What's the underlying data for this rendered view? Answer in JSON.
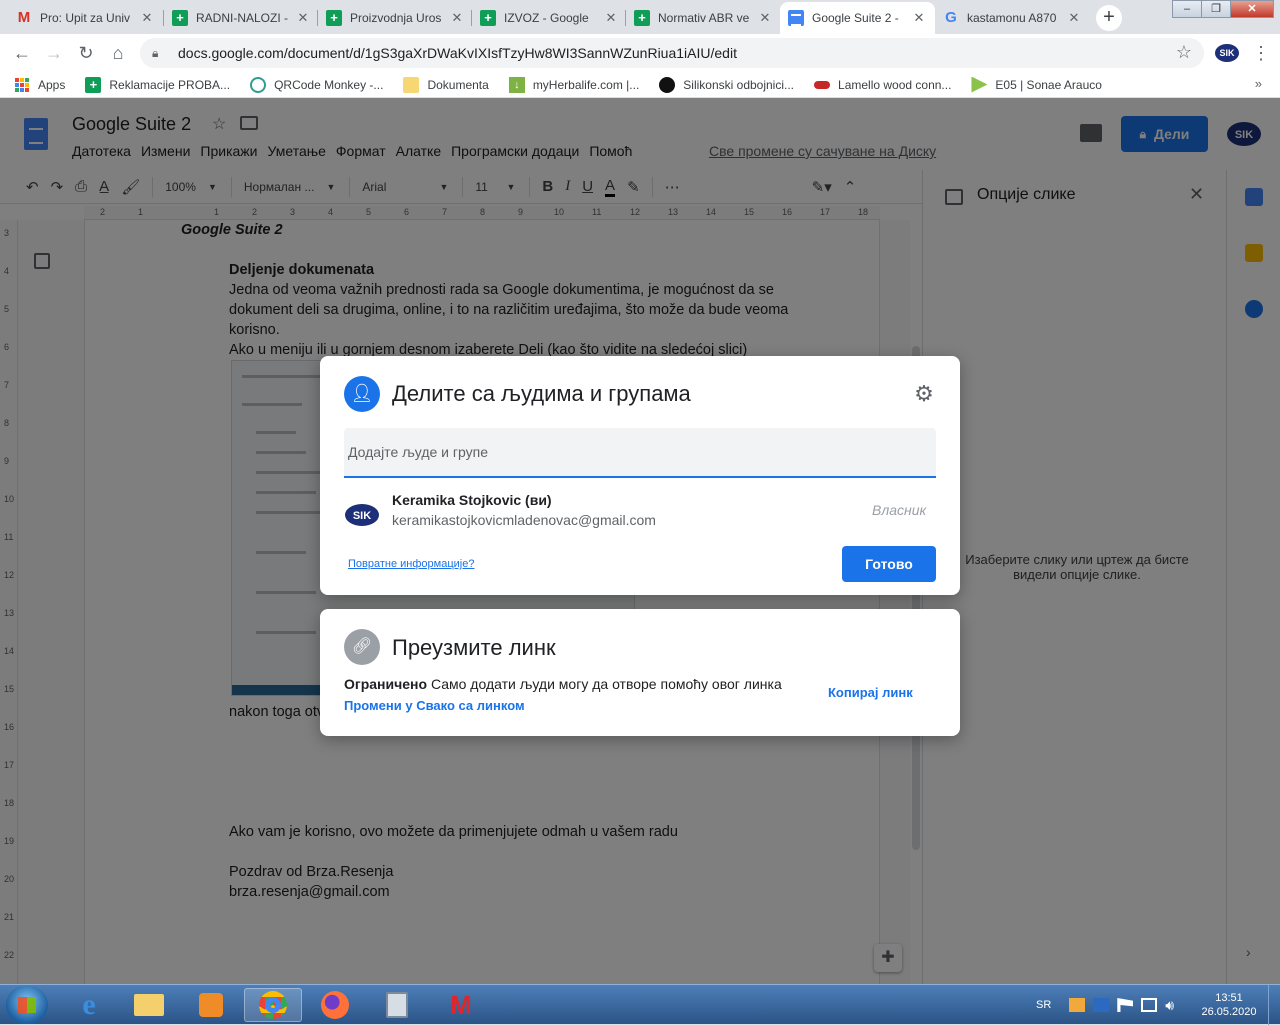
{
  "browser": {
    "tabs": [
      {
        "title": "Pro: Upit za Univ",
        "icon": "gmail-icon"
      },
      {
        "title": "RADNI-NALOZI -",
        "icon": "sheets-icon"
      },
      {
        "title": "Proizvodnja Uros",
        "icon": "sheets-icon"
      },
      {
        "title": "IZVOZ - Google",
        "icon": "sheets-icon"
      },
      {
        "title": "Normativ ABR ve",
        "icon": "sheets-icon"
      },
      {
        "title": "Google Suite 2 -",
        "icon": "docs-icon",
        "active": true
      },
      {
        "title": "kastamonu A870",
        "icon": "google-icon"
      }
    ],
    "url": "docs.google.com/document/d/1gS3gaXrDWaKvIXIsfTzyHw8WI3SannWZunRiua1iAIU/edit",
    "bookmarks": [
      {
        "label": "Apps"
      },
      {
        "label": "Reklamacije PROBA..."
      },
      {
        "label": "QRCode Monkey -..."
      },
      {
        "label": "Dokumenta"
      },
      {
        "label": "myHerbalife.com |..."
      },
      {
        "label": "Silikonski odbojnici..."
      },
      {
        "label": "Lamello wood conn..."
      },
      {
        "label": "E05 | Sonae Arauco"
      }
    ]
  },
  "docs": {
    "title": "Google Suite 2",
    "menu": [
      "Датотека",
      "Измени",
      "Прикажи",
      "Уметање",
      "Формат",
      "Алатке",
      "Програмски додаци",
      "Помоћ"
    ],
    "saved_status": "Све промене су сачуване на Диску",
    "share_label": "Дели",
    "toolbar": {
      "zoom": "100%",
      "style": "Нормалан ...",
      "font": "Arial",
      "size": "11"
    },
    "ruler": [
      "2",
      "1",
      "1",
      "2",
      "3",
      "4",
      "5",
      "6",
      "7",
      "8",
      "9",
      "10",
      "11",
      "12",
      "13",
      "14",
      "15",
      "16",
      "17",
      "18"
    ],
    "vruler": [
      "3",
      "4",
      "5",
      "6",
      "7",
      "8",
      "9",
      "10",
      "11",
      "12",
      "13",
      "14",
      "15",
      "16",
      "17",
      "18",
      "19",
      "20",
      "21",
      "22"
    ],
    "content": {
      "heading": "Google Suite 2",
      "section_title": "Deljenje dokumenata",
      "para1": "Jedna od veoma važnih prednosti rada sa Google dokumentima, je mogućnost da se dokument deli sa drugima, online, i to na različitim uređajima, što može da bude veoma korisno.",
      "para2": "Ako  u meniju ili u gornjem desnom izaberete Deli (kao što vidite na sledećoj slici)",
      "after_image": "nakon toga otv",
      "useful": "Ako vam je korisno, ovo možete da primenjujete odmah u vašem radu",
      "greeting": "Pozdrav od Brza.Resenja",
      "email": "brza.resenja@gmail.com"
    },
    "side_panel": {
      "title": "Опције слике",
      "hint": "Изаберите слику или цртеж да бисте видели опције слике."
    }
  },
  "share_dialog": {
    "title": "Делите са људима и групама",
    "input_placeholder": "Додајте људе и групе",
    "owner_name": "Keramika Stojkovic (ви)",
    "owner_email": "keramikastojkovicmladenovac@gmail.com",
    "owner_role": "Власник",
    "feedback": "Повратне информације?",
    "done": "Готово"
  },
  "link_dialog": {
    "title": "Преузмите линк",
    "restricted": "Ограничено",
    "description": "Само додати људи могу да отворе помоћу овог линка",
    "change": "Промени у Свако са линком",
    "copy": "Копирај линк"
  },
  "taskbar": {
    "language": "SR",
    "time": "13:51",
    "date": "26.05.2020"
  },
  "colors": {
    "accent": "#1a73e8",
    "overlay": "rgba(0,0,0,0.5)",
    "sheets": "#0f9d58",
    "docs": "#4285f4"
  }
}
